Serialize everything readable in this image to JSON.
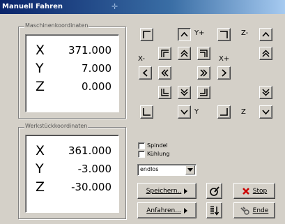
{
  "window": {
    "title": "Manuell Fahren"
  },
  "machine_coords": {
    "label": "Maschinenkoordinaten",
    "rows": [
      {
        "axis": "X",
        "value": "371.000"
      },
      {
        "axis": "Y",
        "value": "7.000"
      },
      {
        "axis": "Z",
        "value": "0.000"
      }
    ]
  },
  "workpiece_coords": {
    "label": "Werkstückkoordinaten",
    "rows": [
      {
        "axis": "X",
        "value": "361.000"
      },
      {
        "axis": "Y",
        "value": "-3.000"
      },
      {
        "axis": "Z",
        "value": "-30.000"
      }
    ]
  },
  "jog_labels": {
    "y_plus": "Y+",
    "x_minus": "X-",
    "x_plus": "X+",
    "y_minus": "Y",
    "z_plus": "Z-",
    "z_minus": "Z"
  },
  "options": {
    "spindle": "Spindel",
    "cooling": "Kühlung",
    "mode": "endlos"
  },
  "buttons": {
    "save": "Speichern..",
    "approach": "Anfahren...",
    "stop": "Stop",
    "end": "Ende"
  },
  "colors": {
    "stop_icon": "#cc0000",
    "titlebar": "#0a246a"
  }
}
